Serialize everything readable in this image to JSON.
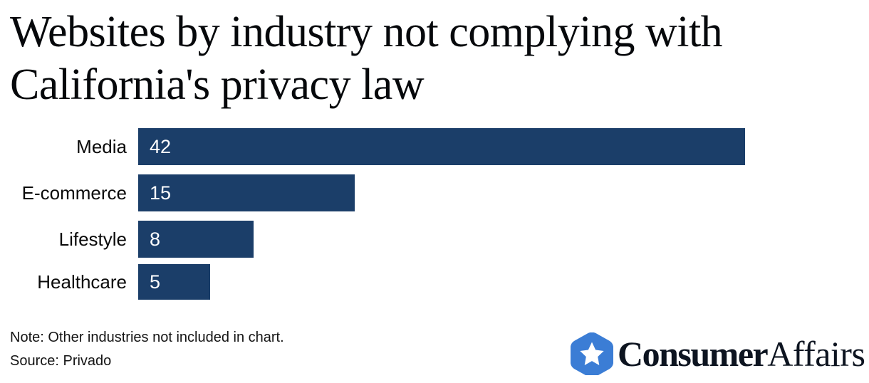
{
  "chart_data": {
    "type": "bar",
    "orientation": "horizontal",
    "title": "Websites by industry not complying with California's privacy law",
    "title_line1": "Websites by industry not complying with",
    "title_line2": "California's privacy law",
    "xlabel": "",
    "ylabel": "",
    "categories": [
      "Media",
      "E-commerce",
      "Lifestyle",
      "Healthcare"
    ],
    "values": [
      42,
      15,
      8,
      5
    ],
    "value_labels": [
      "42",
      "15",
      "8",
      "5"
    ],
    "xlim": [
      0,
      42
    ],
    "grid": false,
    "legend": "none",
    "bar_color": "#1b3e69",
    "value_label_color": "#ffffff",
    "background_color": "#ffffff"
  },
  "footer": {
    "note": "Note: Other industries not included in chart.",
    "source": "Source: Privado"
  },
  "brand": {
    "name_bold": "Consumer",
    "name_light": "Affairs",
    "mark_icon": "hexagon-star-icon",
    "mark_color": "#3b7dd5",
    "star_color": "#ffffff",
    "wordmark_color": "#0d1420"
  }
}
